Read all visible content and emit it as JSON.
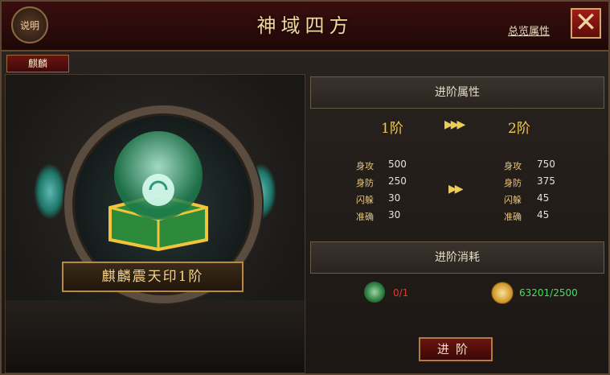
{
  "window": {
    "title": "神域四方",
    "explain_label": "说明",
    "overview_link": "总览属性",
    "close_label": "✕"
  },
  "tabs": [
    {
      "label": "麒麟",
      "active": true
    }
  ],
  "artifact": {
    "name": "麒麟震天印1阶"
  },
  "advance": {
    "header": "进阶属性",
    "from_level": "1阶",
    "to_level": "2阶",
    "stats_from": [
      {
        "name": "身攻",
        "value": "500"
      },
      {
        "name": "身防",
        "value": "250"
      },
      {
        "name": "闪躲",
        "value": "30"
      },
      {
        "name": "准确",
        "value": "30"
      }
    ],
    "stats_to": [
      {
        "name": "身攻",
        "value": "750"
      },
      {
        "name": "身防",
        "value": "375"
      },
      {
        "name": "闪躲",
        "value": "45"
      },
      {
        "name": "准确",
        "value": "45"
      }
    ]
  },
  "consume": {
    "header": "进阶消耗",
    "items": [
      {
        "icon": "dragon-token-icon",
        "text": "0/1",
        "color": "#e23b2e"
      },
      {
        "icon": "gold-coin-icon",
        "text": "63201/2500",
        "color": "#3fe35a"
      }
    ],
    "button_label": "进阶"
  }
}
